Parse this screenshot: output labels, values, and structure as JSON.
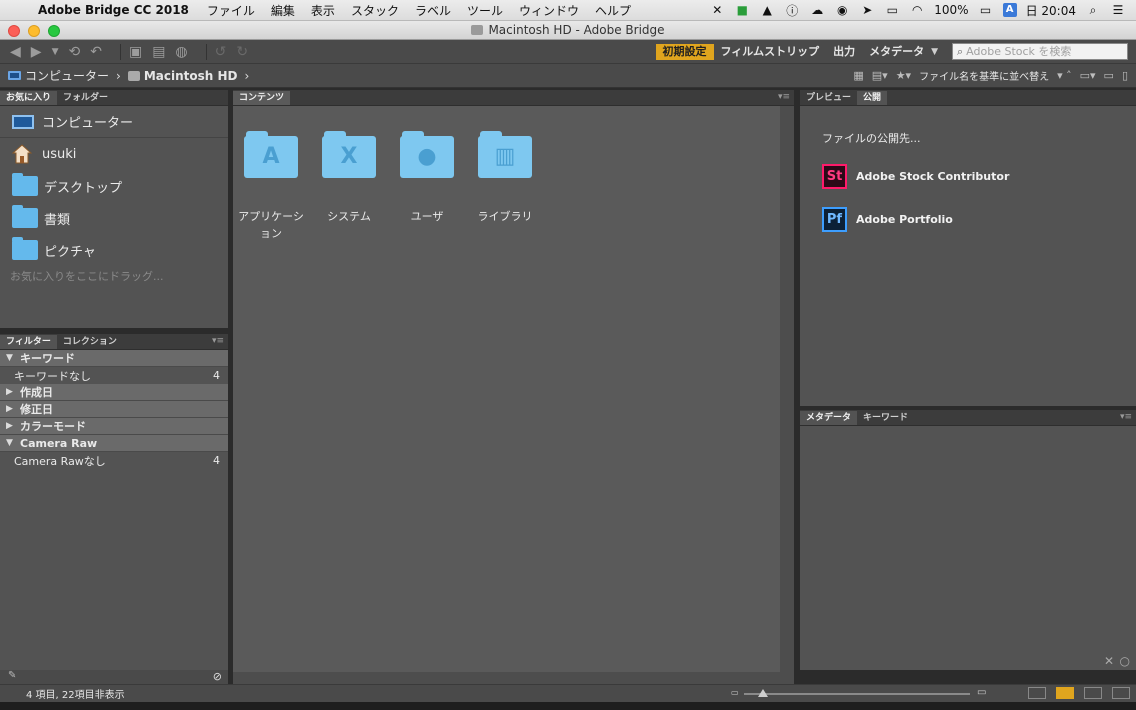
{
  "menubar": {
    "app_name": "Adobe Bridge CC 2018",
    "items": [
      "ファイル",
      "編集",
      "表示",
      "スタック",
      "ラベル",
      "ツール",
      "ウィンドウ",
      "ヘルプ"
    ],
    "battery": "100%",
    "input_badge": "A",
    "clock": "日 20:04"
  },
  "window": {
    "title": "Macintosh HD - Adobe Bridge"
  },
  "toolbar": {
    "workspaces": [
      "初期設定",
      "フィルムストリップ",
      "出力",
      "メタデータ"
    ],
    "search_placeholder": "Adobe Stock を検索"
  },
  "pathbar": {
    "crumbs": [
      "コンピューター",
      "Macintosh HD"
    ],
    "sort_label": "ファイル名を基準に並べ替え"
  },
  "favorites_panel": {
    "tabs": [
      "お気に入り",
      "フォルダー"
    ],
    "items": [
      "コンピューター",
      "usuki",
      "デスクトップ",
      "書類",
      "ピクチャ"
    ],
    "hint": "お気に入りをここにドラッグ..."
  },
  "filter_panel": {
    "tabs": [
      "フィルター",
      "コレクション"
    ],
    "rows": [
      {
        "label": "キーワード",
        "type": "cat",
        "open": true
      },
      {
        "label": "キーワードなし",
        "type": "item",
        "count": "4"
      },
      {
        "label": "作成日",
        "type": "cat",
        "open": false
      },
      {
        "label": "修正日",
        "type": "cat",
        "open": false
      },
      {
        "label": "カラーモード",
        "type": "cat",
        "open": false
      },
      {
        "label": "Camera Raw",
        "type": "cat",
        "open": true
      },
      {
        "label": "Camera Rawなし",
        "type": "item",
        "count": "4"
      }
    ]
  },
  "content_panel": {
    "tab": "コンテンツ",
    "items": [
      {
        "label": "アプリケーション",
        "glyph": "A",
        "icon": "applications-folder-icon"
      },
      {
        "label": "システム",
        "glyph": "X",
        "icon": "system-folder-icon"
      },
      {
        "label": "ユーザ",
        "glyph": "●",
        "icon": "users-folder-icon"
      },
      {
        "label": "ライブラリ",
        "glyph": "▥",
        "icon": "library-folder-icon"
      }
    ]
  },
  "preview_panel": {
    "tabs": [
      "プレビュー",
      "公開"
    ],
    "publish_heading": "ファイルの公開先...",
    "services": [
      {
        "label": "Adobe Stock Contributor",
        "abbr": "St"
      },
      {
        "label": "Adobe Portfolio",
        "abbr": "Pf"
      }
    ]
  },
  "metadata_panel": {
    "tabs": [
      "メタデータ",
      "キーワード"
    ]
  },
  "statusbar": {
    "text": "4 項目, 22項目非表示"
  },
  "colors": {
    "accent": "#e0a51e",
    "panel": "#535353",
    "stock": "#ff1a6a",
    "portfolio": "#3d9eff"
  }
}
